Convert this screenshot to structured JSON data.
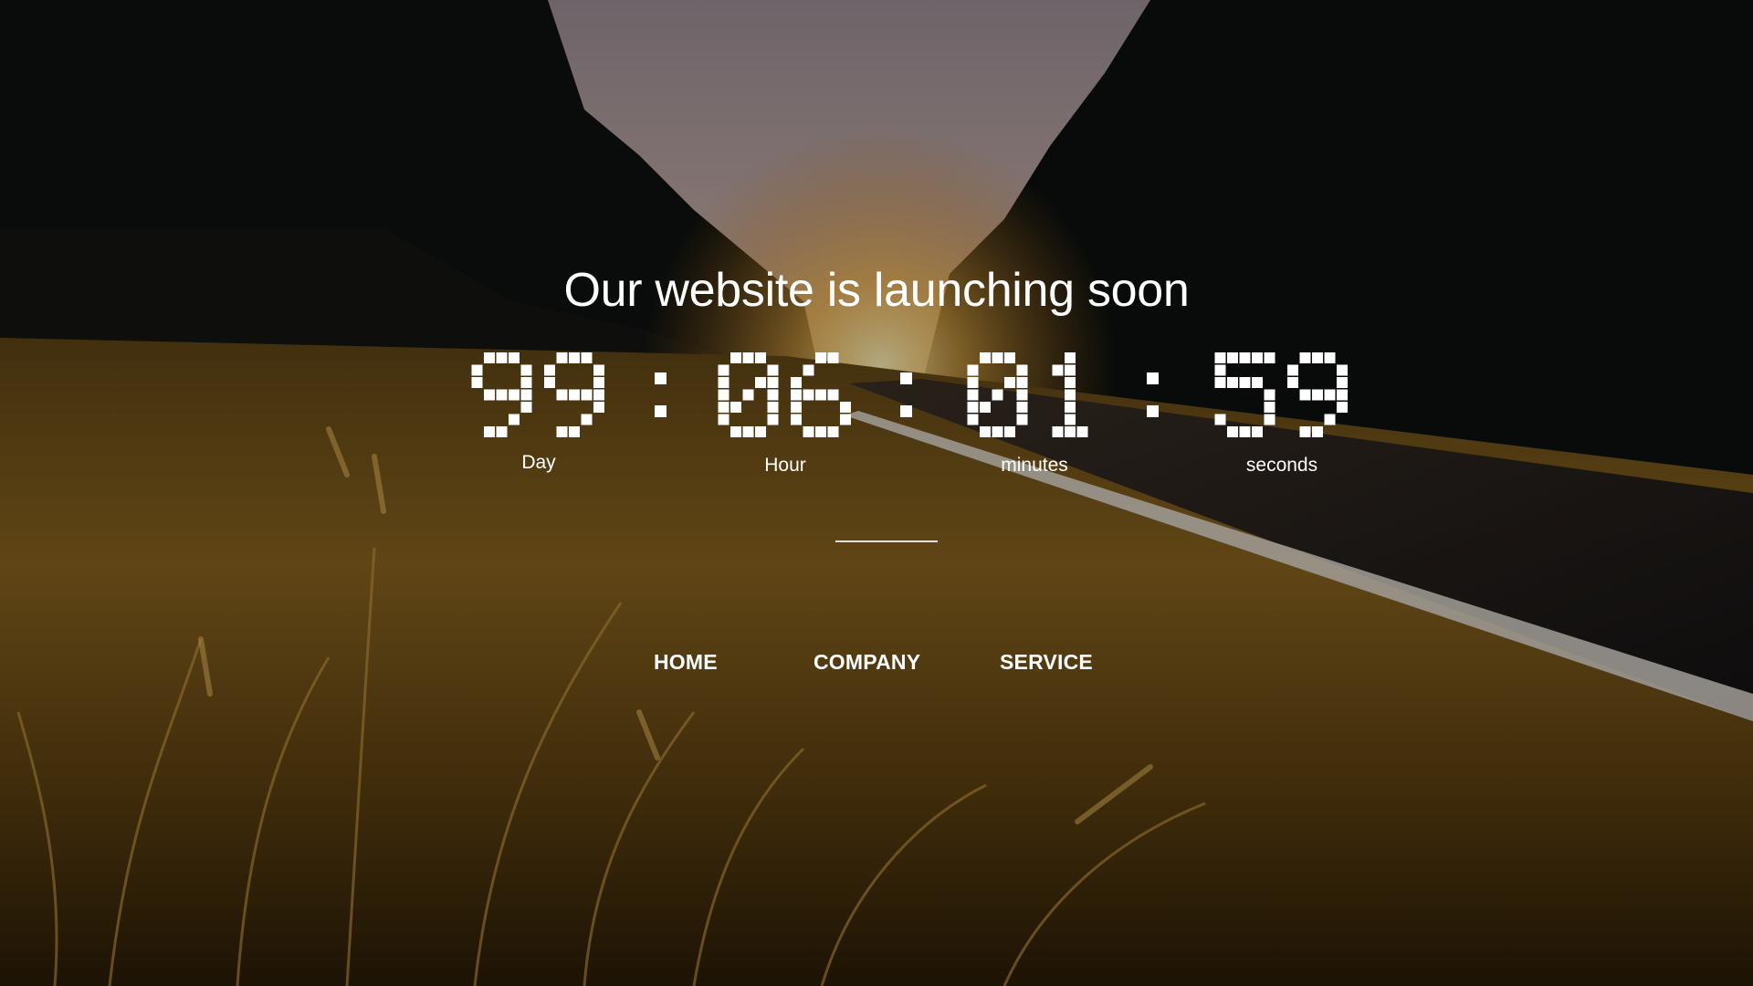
{
  "headline": "Our website is launching soon",
  "countdown": {
    "days": "99",
    "hours": "06",
    "minutes": "01",
    "seconds": "59",
    "separator": ":",
    "labels": {
      "days": "Day",
      "hours": "Hour",
      "minutes": "minutes",
      "seconds": "seconds"
    }
  },
  "nav": {
    "items": [
      {
        "label": "HOME"
      },
      {
        "label": "COMPANY"
      },
      {
        "label": "SERVICE"
      }
    ]
  },
  "colors": {
    "text": "#ffffff",
    "sky": "#b7a8b0",
    "grass": "#8a6420",
    "forest": "#0e1210"
  },
  "background": {
    "icon": "sunset-road-field-photo"
  }
}
